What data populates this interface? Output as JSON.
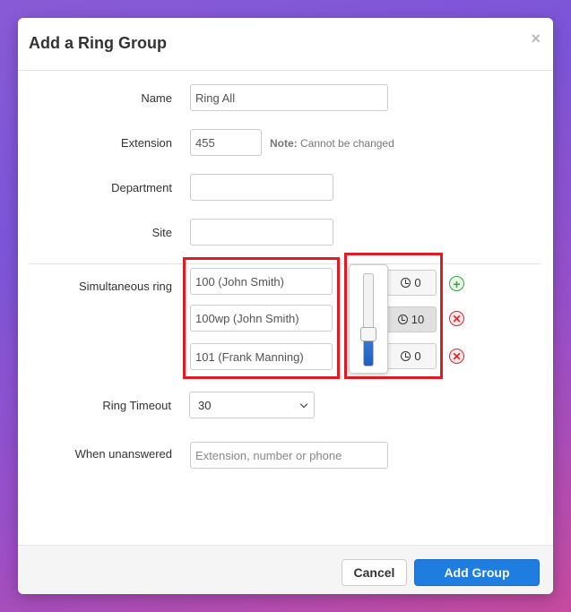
{
  "dialog": {
    "title": "Add a Ring Group",
    "close_glyph": "×"
  },
  "form": {
    "name": {
      "label": "Name",
      "value": "Ring All"
    },
    "extension": {
      "label": "Extension",
      "value": "455",
      "note_bold": "Note:",
      "note_text": " Cannot be changed"
    },
    "department": {
      "label": "Department",
      "value": ""
    },
    "site": {
      "label": "Site",
      "value": ""
    },
    "simultaneous_ring": {
      "label": "Simultaneous ring",
      "entries": [
        {
          "value": "100 (John Smith)",
          "delay": "0",
          "action": "add"
        },
        {
          "value": "100wp (John Smith)",
          "delay": "10",
          "action": "remove"
        },
        {
          "value": "101 (Frank Manning)",
          "delay": "0",
          "action": "remove"
        }
      ],
      "delay_slider_level": 0.35
    },
    "ring_timeout": {
      "label": "Ring Timeout",
      "selected": "30"
    },
    "when_unanswered": {
      "label": "When unanswered",
      "placeholder": "Extension, number or phone"
    }
  },
  "footer": {
    "cancel_label": "Cancel",
    "submit_label": "Add Group"
  },
  "colors": {
    "primary": "#1f7de0",
    "highlight_border": "#e01b24",
    "add": "#3aa342",
    "remove": "#d8262f"
  },
  "icons": {
    "close": "close-icon",
    "clock": "clock-icon",
    "add": "plus-circle-icon",
    "remove": "x-circle-icon",
    "chevron": "chevron-down-icon"
  }
}
